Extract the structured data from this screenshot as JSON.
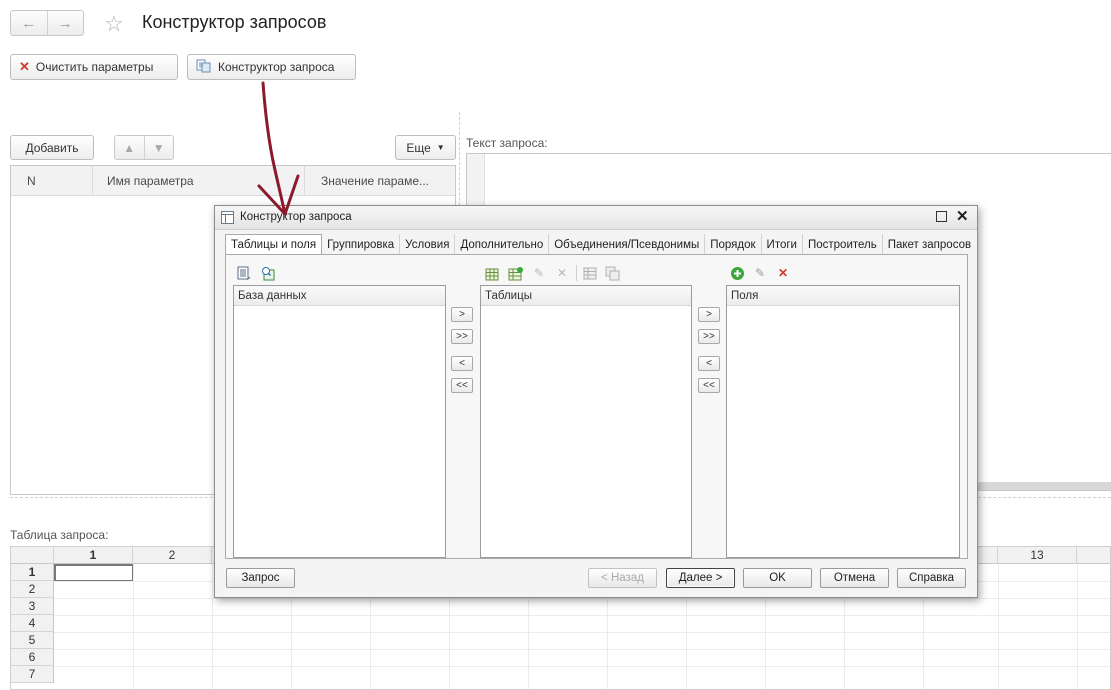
{
  "window": {
    "title": "Конструктор запросов",
    "nav": {
      "back_icon": "arrow-left-icon",
      "forward_icon": "arrow-right-icon"
    },
    "favorite_icon": "star-icon"
  },
  "toolbar": {
    "clear_params_label": "Очистить параметры",
    "query_builder_label": "Конструктор запроса"
  },
  "params": {
    "add_label": "Добавить",
    "more_label": "Еще",
    "columns": [
      "N",
      "Имя параметра",
      "Значение параме..."
    ]
  },
  "query_text_label": "Текст запроса:",
  "query_table_label": "Таблица запроса:",
  "sheet": {
    "columns": [
      "1",
      "2",
      "13"
    ],
    "rows": [
      "1",
      "2",
      "3",
      "4",
      "5",
      "6",
      "7"
    ]
  },
  "dialog": {
    "title": "Конструктор запроса",
    "tabs": [
      "Таблицы и поля",
      "Группировка",
      "Условия",
      "Дополнительно",
      "Объединения/Псевдонимы",
      "Порядок",
      "Итоги",
      "Построитель",
      "Пакет запросов"
    ],
    "lists": {
      "database": "База данных",
      "tables": "Таблицы",
      "fields": "Поля"
    },
    "move_buttons": [
      ">",
      ">>",
      "<",
      "<<"
    ],
    "buttons": {
      "query": "Запрос",
      "back": "< Назад",
      "next": "Далее >",
      "ok": "OK",
      "cancel": "Отмена",
      "help": "Справка"
    }
  },
  "colors": {
    "annotation_arrow": "#8b1a2b",
    "delete_red": "#d23a2a",
    "add_green": "#3aa83a"
  }
}
